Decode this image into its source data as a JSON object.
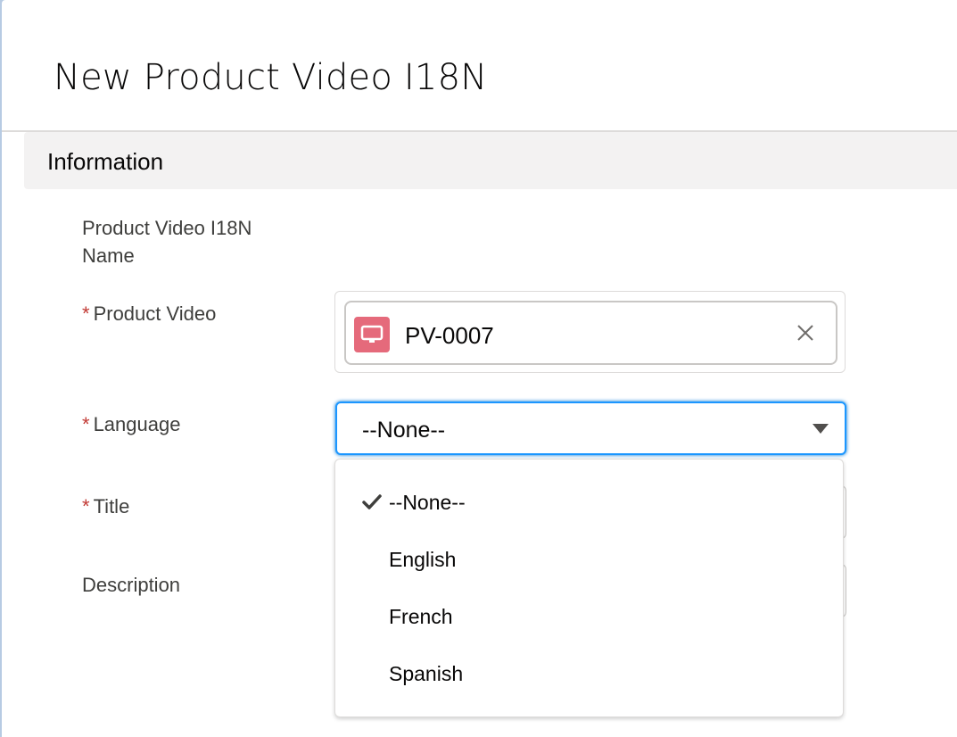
{
  "modal": {
    "title": "New Product Video I18N"
  },
  "section": {
    "title": "Information"
  },
  "fields": {
    "name": {
      "label_line1": "Product Video I18N",
      "label_line2": "Name"
    },
    "product_video": {
      "required_marker": "*",
      "label": "Product Video",
      "value": "PV-0007",
      "icon": "video-monitor-icon",
      "icon_color": "#e56a7b"
    },
    "language": {
      "required_marker": "*",
      "label": "Language",
      "value": "--None--",
      "options": [
        {
          "label": "--None--",
          "selected": true
        },
        {
          "label": "English",
          "selected": false
        },
        {
          "label": "French",
          "selected": false
        },
        {
          "label": "Spanish",
          "selected": false
        }
      ]
    },
    "title": {
      "required_marker": "*",
      "label": "Title"
    },
    "description": {
      "label": "Description"
    }
  },
  "colors": {
    "required": "#c23934",
    "focus_border": "#1b96ff",
    "section_bg": "#f3f2f2"
  }
}
